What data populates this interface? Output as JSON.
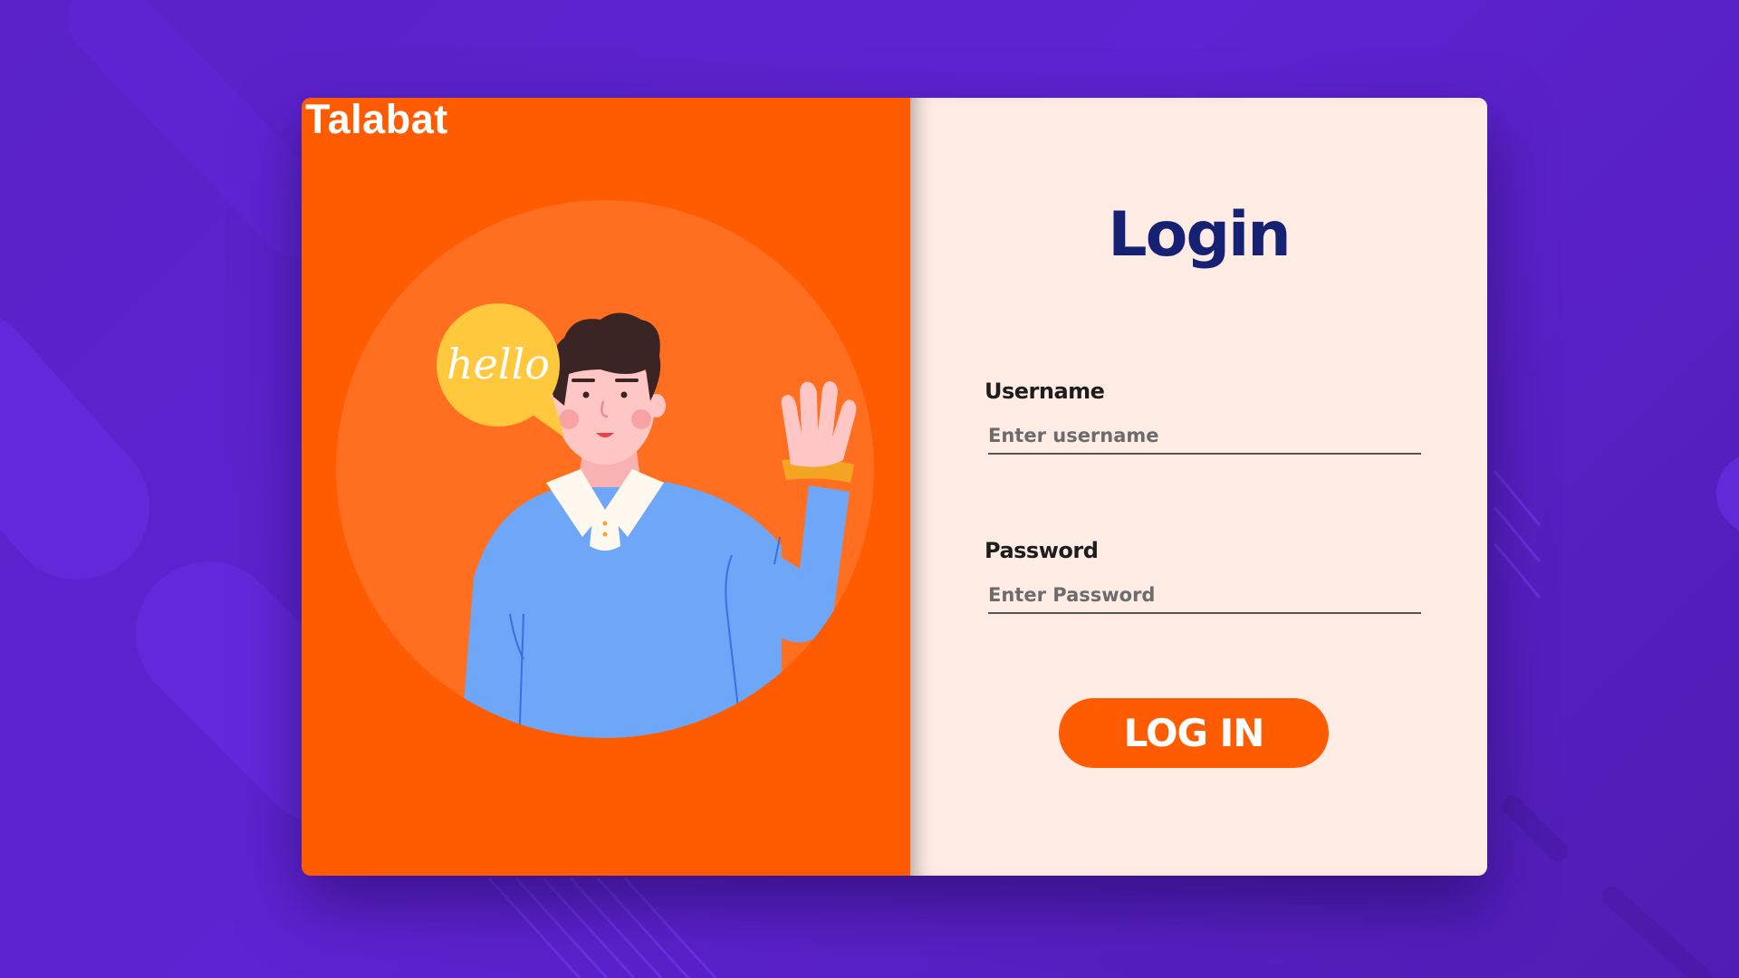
{
  "brand": {
    "name": "Talabat"
  },
  "illustration": {
    "bubble_text": "hello"
  },
  "form": {
    "title": "Login",
    "username": {
      "label": "Username",
      "placeholder": "Enter username",
      "value": ""
    },
    "password": {
      "label": "Password",
      "placeholder": "Enter Password",
      "value": ""
    },
    "submit_label": "LOG IN"
  },
  "colors": {
    "background": "#5e23d2",
    "accent_orange": "#ff5b00",
    "form_panel": "#ffede5",
    "title_navy": "#162174",
    "bubble_yellow": "#ffc83d",
    "sweater_blue": "#6ea6f8"
  }
}
